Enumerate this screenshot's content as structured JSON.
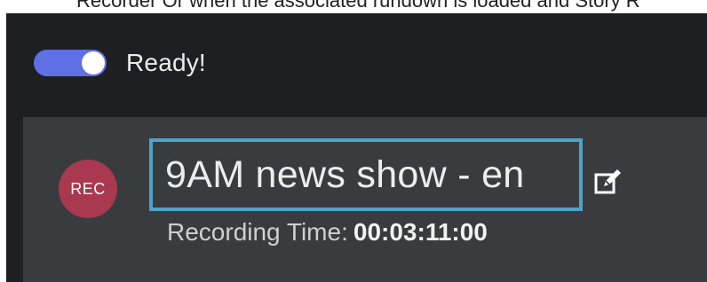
{
  "caption": "Recorder Or when the associated rundown is loaded and Story R",
  "status": {
    "toggle_state": "on",
    "label": "Ready!"
  },
  "recording": {
    "badge": "REC",
    "title": "9AM news show - en",
    "time_label": "Recording Time:",
    "time_value": "00:03:11:00"
  },
  "icons": {
    "edit": "edit-icon"
  },
  "colors": {
    "panel_background": "#1e1f22",
    "card_background": "#3a3b3f",
    "toggle_accent": "#5f6fe6",
    "rec_badge": "#a8394f",
    "title_focus_border": "#4fa3c7"
  }
}
